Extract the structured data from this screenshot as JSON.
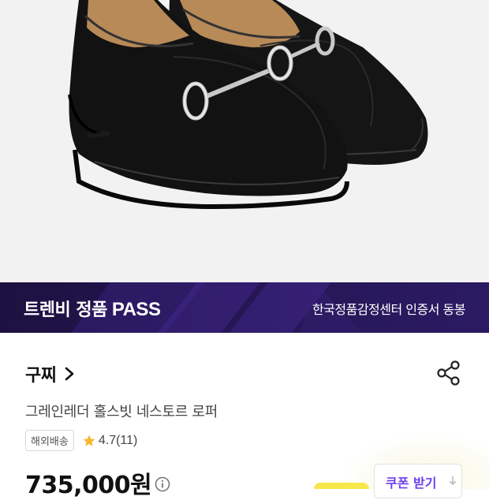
{
  "banner": {
    "title": "트렌비 정품",
    "title_badge": "PASS",
    "subtitle": "한국정품감정센터 인증서 동봉"
  },
  "product": {
    "brand": "구찌",
    "name": "그레인레더 홀스빗 네스토르 로퍼",
    "shipping_badge": "해외배송",
    "rating": "4.7",
    "review_count": "(11)",
    "price": "735,000원"
  },
  "coupon": {
    "label": "쿠폰 받기"
  },
  "icons": {
    "brand_link": "chevron-right-icon",
    "share": "share-icon",
    "rating": "star-icon",
    "price_info": "info-icon",
    "coupon": "download-icon"
  },
  "colors": {
    "banner_bg": "#251653",
    "star": "#f5b82e",
    "coupon_text": "#6b3ff0"
  }
}
